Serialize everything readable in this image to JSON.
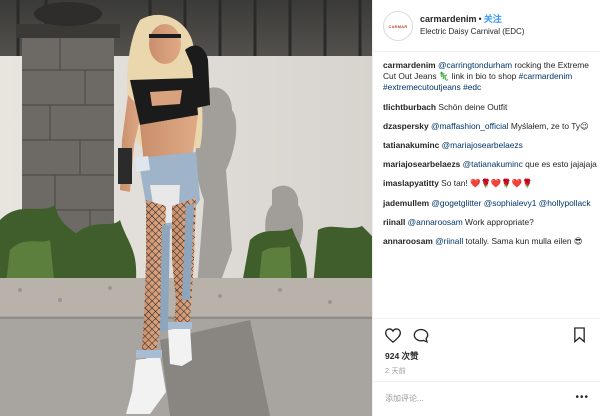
{
  "post": {
    "username": "carmardenim",
    "follow_label": "关注",
    "separator": "•",
    "location": "Electric Daisy Carnival (EDC)",
    "avatar_text": "CARMAR"
  },
  "comments": [
    {
      "user": "carmardenim",
      "parts": [
        {
          "t": " "
        },
        {
          "t": "@carringtondurham",
          "m": true
        },
        {
          "t": " rocking the Extreme Cut Out Jeans 🦎 link in bio to shop "
        },
        {
          "t": "#carmardenim",
          "m": true
        },
        {
          "t": " "
        },
        {
          "t": "#extremecutoutjeans",
          "m": true
        },
        {
          "t": " "
        },
        {
          "t": "#edc",
          "m": true
        }
      ]
    },
    {
      "user": "tlichtburbach",
      "parts": [
        {
          "t": " Schön deine Outfit"
        }
      ]
    },
    {
      "user": "dzaspersky",
      "parts": [
        {
          "t": " "
        },
        {
          "t": "@maffashion_official",
          "m": true
        },
        {
          "t": " Myślałem, ze to Ty😉"
        }
      ]
    },
    {
      "user": "tatianakuminc",
      "parts": [
        {
          "t": " "
        },
        {
          "t": "@mariajosearbelaezs",
          "m": true
        }
      ]
    },
    {
      "user": "mariajosearbelaezs",
      "parts": [
        {
          "t": " "
        },
        {
          "t": "@tatianakuminc",
          "m": true
        },
        {
          "t": " que es esto jajajaja"
        }
      ]
    },
    {
      "user": "imaslapyatitty",
      "parts": [
        {
          "t": " So tan! ❤️🌹❤️🌹❤️🌹"
        }
      ]
    },
    {
      "user": "jademullem",
      "parts": [
        {
          "t": " "
        },
        {
          "t": "@gogetglitter",
          "m": true
        },
        {
          "t": " "
        },
        {
          "t": "@sophialevy1",
          "m": true
        },
        {
          "t": " "
        },
        {
          "t": "@hollypollack",
          "m": true
        }
      ]
    },
    {
      "user": "riinall",
      "parts": [
        {
          "t": " "
        },
        {
          "t": "@annaroosam",
          "m": true
        },
        {
          "t": " Work appropriate?"
        }
      ]
    },
    {
      "user": "annaroosam",
      "parts": [
        {
          "t": " "
        },
        {
          "t": "@riinall",
          "m": true
        },
        {
          "t": " totally. Sama kun mulla eilen 😎"
        }
      ]
    }
  ],
  "actions": {
    "likes": "924 次赞",
    "time_ago": "2 天前",
    "comment_placeholder": "添加评论...",
    "more_label": "•••"
  },
  "colors": {
    "mention": "#003569",
    "follow": "#3897f0",
    "muted": "#999999"
  },
  "icons": [
    "heart-icon",
    "comment-icon",
    "bookmark-icon"
  ]
}
